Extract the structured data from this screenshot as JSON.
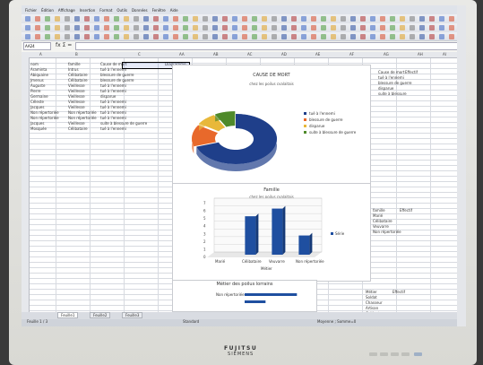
{
  "menu": [
    "Fichier",
    "Édition",
    "Affichage",
    "Insertion",
    "Format",
    "Outils",
    "Données",
    "Fenêtre",
    "Aide"
  ],
  "name_box": "AA24",
  "formula_symbols": "fx Σ =",
  "columns": [
    "A",
    "B",
    "C",
    "AA",
    "AB",
    "AC",
    "AD",
    "AE",
    "AF",
    "AG",
    "AH",
    "AI",
    "AJ"
  ],
  "left_table": {
    "headers": [
      "nom",
      "famille",
      "Cause de mort",
      "Diagramme"
    ],
    "rows": [
      [
        "Araminta",
        "Intrus",
        "tué à l'ennemi"
      ],
      [
        "Abiquaine",
        "Célibataire",
        "blessure de guerre"
      ],
      [
        "Jmenus",
        "Célibataire",
        "blessure de guerre"
      ],
      [
        "Auguste",
        "Vieillesse",
        "tué à l'ennemi"
      ],
      [
        "Pierre",
        "Vieillesse",
        "tué à l'ennemi"
      ],
      [
        "Germaine",
        "Vieillesse",
        "disparue"
      ],
      [
        "Céleste",
        "Vieillesse",
        "tué à l'ennemi"
      ],
      [
        "Jacques",
        "Vieillesse",
        "tué à l'ennemi"
      ],
      [
        "Non répertoriée",
        "Non répertoriée",
        "tué à l'ennemi"
      ],
      [
        "Non répertoriée",
        "Non répertoriée",
        "tué à l'ennemi"
      ],
      [
        "Jacques",
        "Vieillesse",
        "suite à blessure de guerre"
      ],
      [
        "Mosquée",
        "Célibataire",
        "tué à l'ennemi"
      ]
    ]
  },
  "right_table1": {
    "headers": [
      "Cause de mort",
      "Effectif"
    ],
    "rows": [
      [
        "tué à l'ennemi",
        ""
      ],
      [
        "blessure de guerre",
        ""
      ],
      [
        "disparue",
        ""
      ],
      [
        "suite à blessure",
        ""
      ]
    ]
  },
  "right_table2": {
    "headers": [
      "famille",
      "Effectif"
    ],
    "rows": [
      [
        "Marié",
        ""
      ],
      [
        "Célibataire",
        ""
      ],
      [
        "Veuvarre",
        ""
      ],
      [
        "Non répertoriée",
        ""
      ]
    ]
  },
  "right_table3": {
    "headers": [
      "Métier",
      "Effectif"
    ],
    "rows": [
      [
        "Soldat",
        ""
      ],
      [
        "Chasseur",
        ""
      ],
      [
        "Artisan",
        ""
      ],
      [
        "Cultivateur",
        ""
      ]
    ]
  },
  "chart_data": [
    {
      "type": "pie",
      "title": "CAUSE DE MORT",
      "subtitle": "chez les poilus cvalaitais",
      "categories": [
        "tué à l'ennemi",
        "blessure de guerre",
        "disparue",
        "suite à blessure de guerre"
      ],
      "values": [
        70,
        14,
        8,
        8
      ],
      "colors": [
        "#1f3f8a",
        "#e8692b",
        "#e8b83a",
        "#4f8a2a"
      ],
      "legend": "right"
    },
    {
      "type": "bar",
      "title": "Famille",
      "subtitle": "chez les poilus cvalaitais",
      "categories": [
        "Marié",
        "Célibataire",
        "Veuvarre",
        "Non répertoriée"
      ],
      "series": [
        {
          "name": "Série",
          "values": [
            0,
            5,
            6,
            2.5
          ]
        }
      ],
      "ylim": [
        0,
        7
      ],
      "yticks": [
        0,
        1,
        2,
        3,
        4,
        5,
        6,
        7
      ],
      "xlabel": "Métier",
      "color": "#1f4fa0",
      "legend": "right"
    },
    {
      "type": "bar",
      "title": "Métier des poilus lorrains",
      "categories": [
        "Non répertoriée",
        ""
      ],
      "values": [
        5,
        2
      ],
      "color": "#1f4fa0"
    }
  ],
  "sheet_tabs": [
    "Feuille1",
    "Feuille2",
    "Feuille3"
  ],
  "status": {
    "left": "Feuille 1 / 3",
    "mid": "Standard",
    "right": "Moyenne ; Somme=0"
  },
  "monitor": {
    "brand": "FUJITSU",
    "sub": "SIEMENS"
  }
}
